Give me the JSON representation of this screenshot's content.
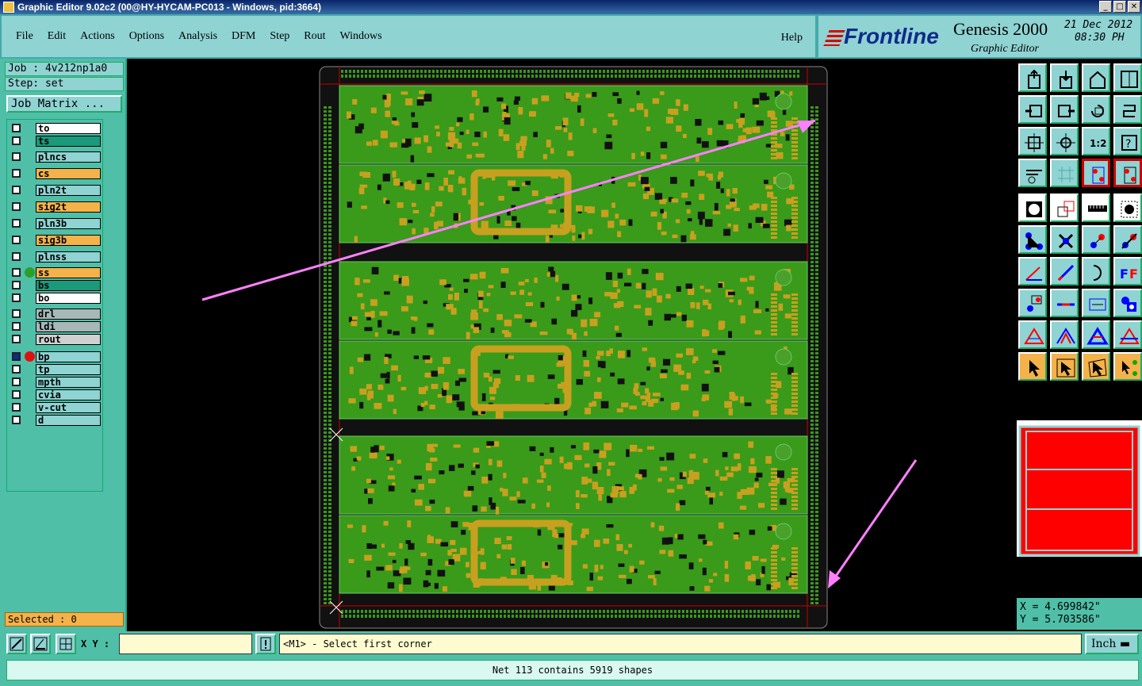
{
  "window": {
    "title": "Graphic Editor 9.02c2 (00@HY-HYCAM-PC013 - Windows, pid:3664)",
    "minimize": "_",
    "maximize": "□",
    "close": "✕"
  },
  "menu": {
    "items": [
      "File",
      "Edit",
      "Actions",
      "Options",
      "Analysis",
      "DFM",
      "Step",
      "Rout",
      "Windows"
    ],
    "help": "Help"
  },
  "brand": {
    "logo": "Frontline",
    "product": "Genesis 2000",
    "subtitle": "Graphic Editor",
    "date": "21 Dec 2012",
    "time": "08:30 PH"
  },
  "job": {
    "job_label": "Job : 4v212np1a0",
    "step_label": "Step: set",
    "matrix_button": "Job Matrix ..."
  },
  "layers": [
    {
      "name": "to",
      "color": "#ffffff"
    },
    {
      "name": "ts",
      "color": "#1a9a7a"
    },
    {
      "name": "plncs",
      "color": "#8fd3d3"
    },
    {
      "name": "cs",
      "color": "#f4b24a"
    },
    {
      "name": "pln2t",
      "color": "#8fd3d3"
    },
    {
      "name": "sig2t",
      "color": "#f4b24a"
    },
    {
      "name": "pln3b",
      "color": "#8fd3d3"
    },
    {
      "name": "sig3b",
      "color": "#f4b24a"
    },
    {
      "name": "plnss",
      "color": "#8fd3d3"
    },
    {
      "name": "ss",
      "color": "#f4b24a"
    },
    {
      "name": "bs",
      "color": "#1a9a7a"
    },
    {
      "name": "bo",
      "color": "#ffffff"
    },
    {
      "name": "drl",
      "color": "#a8b8b8"
    },
    {
      "name": "ldi",
      "color": "#a8b8b8"
    },
    {
      "name": "rout",
      "color": "#d0d0d0"
    },
    {
      "name": "bp",
      "color": "#8fd3d3"
    },
    {
      "name": "tp",
      "color": "#8fd3d3"
    },
    {
      "name": "mpth",
      "color": "#8fd3d3"
    },
    {
      "name": "cvia",
      "color": "#8fd3d3"
    },
    {
      "name": "v-cut",
      "color": "#8fd3d3"
    },
    {
      "name": "d",
      "color": "#8fd3d3"
    }
  ],
  "selected": "Selected : 0",
  "coords": {
    "x": "X = 4.699842\"",
    "y": "Y = 5.703586\""
  },
  "bottom": {
    "xy_label": "X Y :",
    "xy_value": "",
    "message": "<M1> - Select first corner",
    "units": "Inch"
  },
  "status": "Net 113 contains 5919 shapes",
  "colors": {
    "board_green": "#3a9a1a",
    "pad_gold": "#c8a020",
    "annotation_pink": "#ff80ff",
    "preview_red": "#ff0000"
  }
}
